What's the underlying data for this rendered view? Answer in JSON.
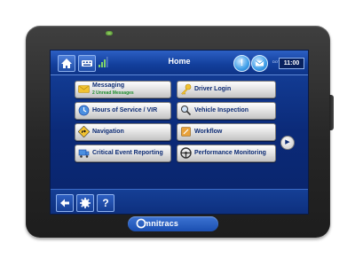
{
  "header": {
    "title": "Home",
    "clock_prefix": "DOT",
    "clock": "11:00"
  },
  "menu": {
    "messaging": {
      "label": "Messaging",
      "sublabel": "2 Unread Messages"
    },
    "driver_login": {
      "label": "Driver Login"
    },
    "hours_of_service": {
      "label": "Hours of Service / VIR"
    },
    "vehicle_inspection": {
      "label": "Vehicle Inspection"
    },
    "navigation": {
      "label": "Navigation"
    },
    "workflow": {
      "label": "Workflow"
    },
    "critical_event": {
      "label": "Critical Event Reporting"
    },
    "performance": {
      "label": "Performance Monitoring"
    }
  },
  "footer": {
    "help_label": "?"
  },
  "brand": {
    "name": "mnitracs",
    "accent": "#1b4fb1"
  },
  "icons": {
    "home": "home-icon",
    "keyboard": "keyboard-icon",
    "signal": "signal-icon",
    "alert": "alert-icon",
    "mail": "mail-icon",
    "back": "back-arrow-icon",
    "settings": "gear-icon",
    "next": "next-arrow-icon"
  }
}
